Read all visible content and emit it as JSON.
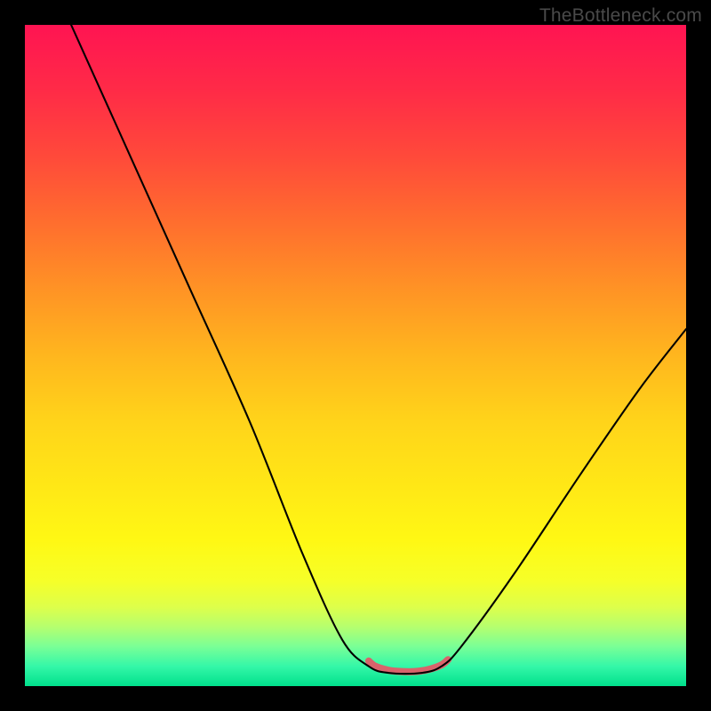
{
  "watermark": {
    "text": "TheBottleneck.com"
  },
  "gradient": {
    "stops": [
      {
        "offset": 0.0,
        "color": "#ff1452"
      },
      {
        "offset": 0.1,
        "color": "#ff2b47"
      },
      {
        "offset": 0.2,
        "color": "#ff4a3a"
      },
      {
        "offset": 0.3,
        "color": "#ff6e2e"
      },
      {
        "offset": 0.4,
        "color": "#ff9325"
      },
      {
        "offset": 0.5,
        "color": "#ffb61e"
      },
      {
        "offset": 0.6,
        "color": "#ffd41a"
      },
      {
        "offset": 0.7,
        "color": "#ffe816"
      },
      {
        "offset": 0.78,
        "color": "#fff814"
      },
      {
        "offset": 0.84,
        "color": "#f6ff28"
      },
      {
        "offset": 0.88,
        "color": "#deff4a"
      },
      {
        "offset": 0.91,
        "color": "#b6ff6e"
      },
      {
        "offset": 0.94,
        "color": "#7aff96"
      },
      {
        "offset": 0.97,
        "color": "#34f7a8"
      },
      {
        "offset": 1.0,
        "color": "#00e08c"
      }
    ]
  },
  "chart_data": {
    "type": "line",
    "title": "",
    "xlabel": "",
    "ylabel": "",
    "xlim": [
      0,
      100
    ],
    "ylim": [
      0,
      100
    ],
    "series": [
      {
        "name": "bottleneck-curve",
        "points": [
          {
            "x": 7,
            "y": 100
          },
          {
            "x": 16,
            "y": 80
          },
          {
            "x": 25,
            "y": 60
          },
          {
            "x": 34,
            "y": 40
          },
          {
            "x": 42,
            "y": 20
          },
          {
            "x": 48,
            "y": 7
          },
          {
            "x": 52,
            "y": 3
          },
          {
            "x": 55,
            "y": 2
          },
          {
            "x": 60,
            "y": 2
          },
          {
            "x": 63,
            "y": 3
          },
          {
            "x": 66,
            "y": 6
          },
          {
            "x": 74,
            "y": 17
          },
          {
            "x": 84,
            "y": 32
          },
          {
            "x": 93,
            "y": 45
          },
          {
            "x": 100,
            "y": 54
          }
        ]
      },
      {
        "name": "optimal-band",
        "stroke": "#d9636b",
        "width": 8,
        "points": [
          {
            "x": 52,
            "y": 3.8
          },
          {
            "x": 53,
            "y": 3.0
          },
          {
            "x": 55,
            "y": 2.4
          },
          {
            "x": 57,
            "y": 2.2
          },
          {
            "x": 59,
            "y": 2.2
          },
          {
            "x": 61,
            "y": 2.5
          },
          {
            "x": 63,
            "y": 3.2
          },
          {
            "x": 64,
            "y": 4.0
          }
        ]
      }
    ]
  }
}
